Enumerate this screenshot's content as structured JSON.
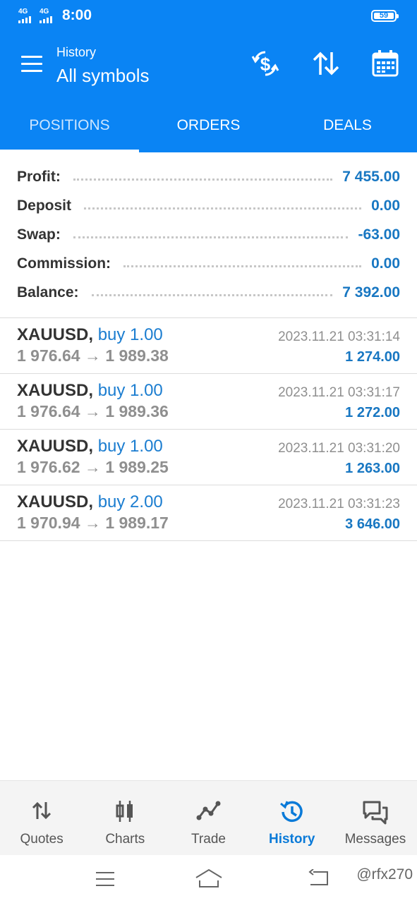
{
  "status_bar": {
    "network_1": "4G",
    "network_2": "4G",
    "time": "8:00",
    "battery": "59"
  },
  "app_bar": {
    "subtitle": "History",
    "title": "All symbols",
    "icons": [
      "currency-exchange-icon",
      "sort-icon",
      "calendar-icon"
    ]
  },
  "tabs": [
    {
      "label": "POSITIONS",
      "active": true
    },
    {
      "label": "ORDERS",
      "active": false
    },
    {
      "label": "DEALS",
      "active": false
    }
  ],
  "summary": {
    "profit_label": "Profit:",
    "profit_value": "7 455.00",
    "deposit_label": "Deposit",
    "deposit_value": "0.00",
    "swap_label": "Swap:",
    "swap_value": "-63.00",
    "commission_label": "Commission:",
    "commission_value": "0.00",
    "balance_label": "Balance:",
    "balance_value": "7 392.00"
  },
  "deals": [
    {
      "symbol": "XAUUSD,",
      "type": "buy 1.00",
      "open": "1 976.64",
      "close": "1 989.38",
      "time": "2023.11.21 03:31:14",
      "profit": "1 274.00"
    },
    {
      "symbol": "XAUUSD,",
      "type": "buy 1.00",
      "open": "1 976.64",
      "close": "1 989.36",
      "time": "2023.11.21 03:31:17",
      "profit": "1 272.00"
    },
    {
      "symbol": "XAUUSD,",
      "type": "buy 1.00",
      "open": "1 976.62",
      "close": "1 989.25",
      "time": "2023.11.21 03:31:20",
      "profit": "1 263.00"
    },
    {
      "symbol": "XAUUSD,",
      "type": "buy 2.00",
      "open": "1 970.94",
      "close": "1 989.17",
      "time": "2023.11.21 03:31:23",
      "profit": "3 646.00"
    }
  ],
  "arrow": "→",
  "bottom_nav": [
    {
      "label": "Quotes",
      "icon": "quotes-icon",
      "active": false
    },
    {
      "label": "Charts",
      "icon": "charts-icon",
      "active": false
    },
    {
      "label": "Trade",
      "icon": "trade-icon",
      "active": false
    },
    {
      "label": "History",
      "icon": "history-icon",
      "active": true
    },
    {
      "label": "Messages",
      "icon": "messages-icon",
      "active": false
    }
  ],
  "system_nav": {
    "icons": [
      "recents-icon",
      "home-icon",
      "back-icon"
    ],
    "watermark": "@rfx270"
  },
  "colors": {
    "accent": "#0a84f4",
    "value": "#1877c2",
    "active_nav": "#0a7ad8"
  }
}
